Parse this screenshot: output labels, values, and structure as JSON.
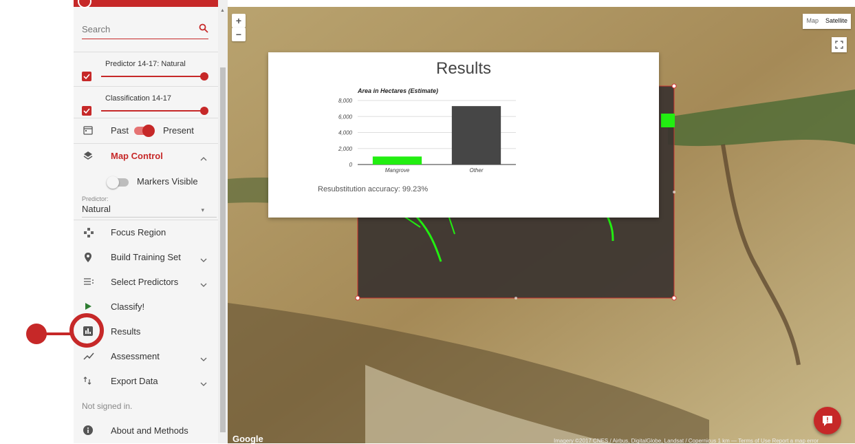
{
  "sidebar": {
    "search": {
      "placeholder": "Search",
      "icon": "search-icon"
    },
    "layers": [
      {
        "name": "Predictor 14-17: Natural",
        "checked": true
      },
      {
        "name": "Classification 14-17",
        "checked": true
      }
    ],
    "time_toggle": {
      "past": "Past",
      "present": "Present"
    },
    "map_control": {
      "label": "Map Control",
      "markers_label": "Markers Visible"
    },
    "predictor": {
      "label": "Predictor:",
      "value": "Natural"
    },
    "items": [
      {
        "label": "Focus Region",
        "icon": "focus-region-icon"
      },
      {
        "label": "Build Training Set",
        "icon": "location-pin-icon"
      },
      {
        "label": "Select Predictors",
        "icon": "list-icon"
      },
      {
        "label": "Classify!",
        "icon": "play-icon"
      },
      {
        "label": "Results",
        "icon": "bar-chart-icon"
      },
      {
        "label": "Assessment",
        "icon": "trend-icon"
      },
      {
        "label": "Export Data",
        "icon": "sort-arrows-icon"
      }
    ],
    "signin_status": "Not signed in.",
    "about": "About and Methods"
  },
  "map": {
    "zoom_in": "+",
    "zoom_out": "−",
    "type_map": "Map",
    "type_satellite": "Satellite",
    "logo": "Google",
    "attribution": "Imagery ©2017 CNES / Airbus, DigitalGlobe, Landsat / Copernicus    1 km —    Terms of Use   Report a map error"
  },
  "results": {
    "title": "Results",
    "accuracy": "Resubstitution accuracy: 99.23%"
  },
  "chart_data": {
    "type": "bar",
    "title": "Area in Hectares (Estimate)",
    "categories": [
      "Mangrove",
      "Other"
    ],
    "values": [
      1000,
      7300
    ],
    "colors": [
      "#22ee11",
      "#464646"
    ],
    "ylim": [
      0,
      8000
    ],
    "yticks": [
      0,
      2000,
      4000,
      6000,
      8000
    ],
    "ytick_labels": [
      "0",
      "2,000",
      "4,000",
      "6,000",
      "8,000"
    ],
    "grid": true,
    "xlabel": "",
    "ylabel": ""
  },
  "colors": {
    "accent": "#c62828"
  }
}
